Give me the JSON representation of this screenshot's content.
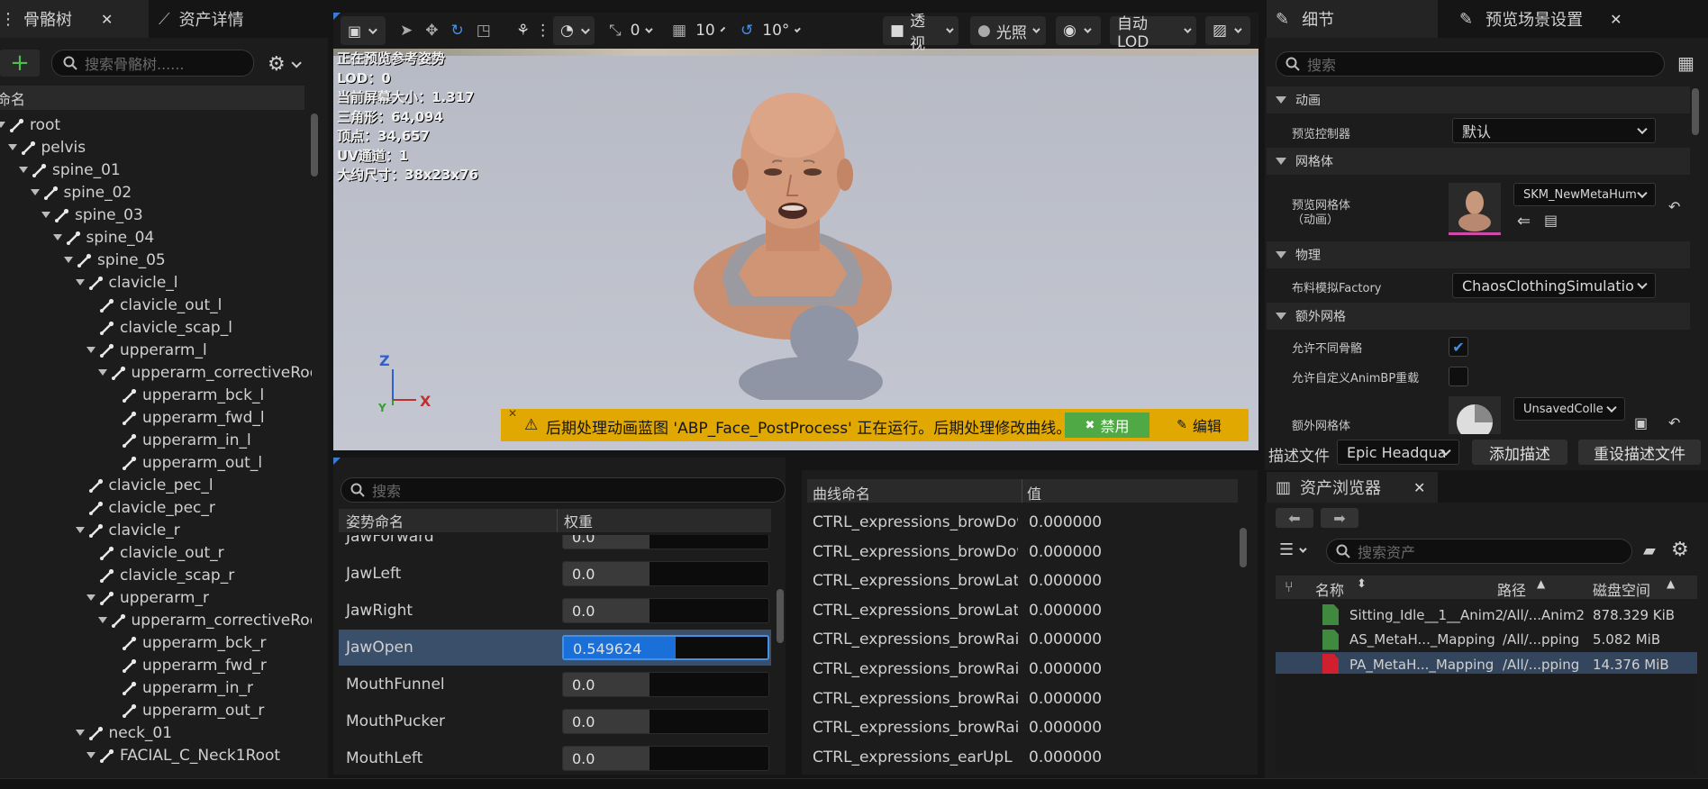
{
  "left_panel": {
    "tabs": {
      "skeleton_tree": "骨骼树",
      "asset_details": "资产详情"
    },
    "search_placeholder": "搜索骨骼树......",
    "column_header": "命名",
    "bones": [
      {
        "name": "root",
        "level": 0,
        "expanded": true
      },
      {
        "name": "pelvis",
        "level": 1,
        "expanded": true
      },
      {
        "name": "spine_01",
        "level": 2,
        "expanded": true
      },
      {
        "name": "spine_02",
        "level": 3,
        "expanded": true
      },
      {
        "name": "spine_03",
        "level": 4,
        "expanded": true
      },
      {
        "name": "spine_04",
        "level": 5,
        "expanded": true
      },
      {
        "name": "spine_05",
        "level": 6,
        "expanded": true
      },
      {
        "name": "clavicle_l",
        "level": 7,
        "expanded": true
      },
      {
        "name": "clavicle_out_l",
        "level": 8,
        "expanded": false
      },
      {
        "name": "clavicle_scap_l",
        "level": 8,
        "expanded": false
      },
      {
        "name": "upperarm_l",
        "level": 8,
        "expanded": true
      },
      {
        "name": "upperarm_correctiveRoot_l",
        "level": 9,
        "expanded": true
      },
      {
        "name": "upperarm_bck_l",
        "level": 10,
        "expanded": false
      },
      {
        "name": "upperarm_fwd_l",
        "level": 10,
        "expanded": false
      },
      {
        "name": "upperarm_in_l",
        "level": 10,
        "expanded": false
      },
      {
        "name": "upperarm_out_l",
        "level": 10,
        "expanded": false
      },
      {
        "name": "clavicle_pec_l",
        "level": 7,
        "expanded": false
      },
      {
        "name": "clavicle_pec_r",
        "level": 7,
        "expanded": false
      },
      {
        "name": "clavicle_r",
        "level": 7,
        "expanded": true
      },
      {
        "name": "clavicle_out_r",
        "level": 8,
        "expanded": false
      },
      {
        "name": "clavicle_scap_r",
        "level": 8,
        "expanded": false
      },
      {
        "name": "upperarm_r",
        "level": 8,
        "expanded": true
      },
      {
        "name": "upperarm_correctiveRoot_r",
        "level": 9,
        "expanded": true
      },
      {
        "name": "upperarm_bck_r",
        "level": 10,
        "expanded": false
      },
      {
        "name": "upperarm_fwd_r",
        "level": 10,
        "expanded": false
      },
      {
        "name": "upperarm_in_r",
        "level": 10,
        "expanded": false
      },
      {
        "name": "upperarm_out_r",
        "level": 10,
        "expanded": false
      },
      {
        "name": "neck_01",
        "level": 7,
        "expanded": true
      },
      {
        "name": "FACIAL_C_Neck1Root",
        "level": 8,
        "expanded": true
      }
    ]
  },
  "toolbar": {
    "snap_translate": "0",
    "snap_rotate": "10",
    "snap_scale": "10°",
    "view_mode": "透视",
    "lighting": "光照",
    "lod": "自动LOD"
  },
  "viewport": {
    "stats": [
      "正在预览参考姿势",
      "LOD：0",
      "当前屏幕大小：1.317",
      "三角形：64,094",
      "顶点：34,657",
      "UV通道：1",
      "大约尺寸：38x23x76"
    ],
    "axis_z": "Z",
    "axis_x": "X",
    "axis_y": "Y",
    "notice": "后期处理动画蓝图 'ABP_Face_PostProcess' 正在运行。后期处理修改曲线。",
    "disable_label": "禁用",
    "edit_label": "编辑"
  },
  "pose_panel": {
    "search_placeholder": "搜索",
    "col_name": "姿势命名",
    "col_weight": "权重",
    "rows": [
      {
        "name": "JawForward",
        "value": "0.0",
        "fraction": 0.0,
        "selected": false
      },
      {
        "name": "JawLeft",
        "value": "0.0",
        "fraction": 0.0,
        "selected": false
      },
      {
        "name": "JawRight",
        "value": "0.0",
        "fraction": 0.0,
        "selected": false
      },
      {
        "name": "JawOpen",
        "value": "0.549624",
        "fraction": 0.549624,
        "selected": true
      },
      {
        "name": "MouthFunnel",
        "value": "0.0",
        "fraction": 0.0,
        "selected": false
      },
      {
        "name": "MouthPucker",
        "value": "0.0",
        "fraction": 0.0,
        "selected": false
      },
      {
        "name": "MouthLeft",
        "value": "0.0",
        "fraction": 0.0,
        "selected": false
      }
    ]
  },
  "curve_panel": {
    "col_name": "曲线命名",
    "col_value": "值",
    "rows": [
      {
        "name": "CTRL_expressions_browDow",
        "value": "0.000000"
      },
      {
        "name": "CTRL_expressions_browDow",
        "value": "0.000000"
      },
      {
        "name": "CTRL_expressions_browLate",
        "value": "0.000000"
      },
      {
        "name": "CTRL_expressions_browLate",
        "value": "0.000000"
      },
      {
        "name": "CTRL_expressions_browRais",
        "value": "0.000000"
      },
      {
        "name": "CTRL_expressions_browRais",
        "value": "0.000000"
      },
      {
        "name": "CTRL_expressions_browRais",
        "value": "0.000000"
      },
      {
        "name": "CTRL_expressions_browRais",
        "value": "0.000000"
      },
      {
        "name": "CTRL_expressions_earUpL",
        "value": "0.000000"
      }
    ]
  },
  "details": {
    "tabs": {
      "details": "细节",
      "preview_scene": "预览场景设置"
    },
    "search_placeholder": "搜索",
    "sections": {
      "animation": "动画",
      "mesh": "网格体",
      "physics": "物理",
      "extra_mesh": "额外网格"
    },
    "preview_controller_label": "预览控制器",
    "preview_controller_value": "默认",
    "preview_mesh_label_1": "预览网格体",
    "preview_mesh_label_2": "（动画）",
    "preview_mesh_value": "SKM_NewMetaHum",
    "cloth_factory_label": "布料模拟Factory",
    "cloth_factory_value": "ChaosClothingSimulatio",
    "allow_diff_skel_label": "允许不同骨骼",
    "allow_diff_skel_checked": true,
    "allow_custom_animbp_label": "允许自定义AnimBP重载",
    "allow_custom_animbp_checked": false,
    "extra_mesh_label": "额外网格体",
    "extra_mesh_value": "UnsavedColle",
    "profile_label": "描述文件",
    "profile_value": "Epic Headqua",
    "add_profile": "添加描述",
    "reset_profile": "重设描述文件"
  },
  "asset_browser": {
    "title": "资产浏览器",
    "search_placeholder": "搜索资产",
    "col_name": "名称",
    "col_path": "路径",
    "col_disk": "磁盘空间",
    "rows": [
      {
        "name": "Sitting_Idle__1__Anim2",
        "path": "/All/...Anim2",
        "size": "878.329 KiB",
        "color": "#3f8a3f",
        "selected": false
      },
      {
        "name": "AS_MetaH..._Mapping",
        "path": "/All/...pping",
        "size": "5.082 MiB",
        "color": "#3f8a3f",
        "selected": false
      },
      {
        "name": "PA_MetaH..._Mapping",
        "path": "/All/...pping",
        "size": "14.376 MiB",
        "color": "#d02030",
        "selected": true
      }
    ]
  }
}
